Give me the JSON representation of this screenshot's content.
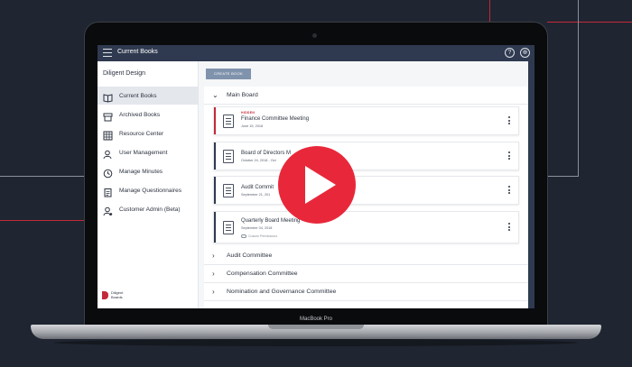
{
  "app": {
    "title": "Current Books",
    "org_name": "Diligent Design",
    "help_icon": "help-icon",
    "globe_icon": "globe-icon"
  },
  "sidebar": {
    "items": [
      {
        "label": "Current Books",
        "icon": "book-open-icon",
        "active": true
      },
      {
        "label": "Archived Books",
        "icon": "archive-icon",
        "active": false
      },
      {
        "label": "Resource Center",
        "icon": "grid-icon",
        "active": false
      },
      {
        "label": "User Management",
        "icon": "users-icon",
        "active": false
      },
      {
        "label": "Manage Minutes",
        "icon": "clock-icon",
        "active": false
      },
      {
        "label": "Manage Questionnaires",
        "icon": "clipboard-icon",
        "active": false
      },
      {
        "label": "Customer Admin (Beta)",
        "icon": "admin-icon",
        "active": false
      }
    ],
    "brand": {
      "line1": "Diligent",
      "line2": "Boards"
    }
  },
  "toolbar": {
    "create_label": "CREATE BOOK"
  },
  "sections": [
    {
      "label": "Main Board",
      "expanded": true
    },
    {
      "label": "Audit Committee",
      "expanded": false
    },
    {
      "label": "Compensation Committee",
      "expanded": false
    },
    {
      "label": "Nomination and Governance Committee",
      "expanded": false
    }
  ],
  "books": [
    {
      "tag": "HIDDEN",
      "title": "Finance Committee Meeting",
      "date": "June 15, 2018",
      "permissions": "",
      "stripe": "#c4293a"
    },
    {
      "tag": "",
      "title": "Board of Directors M",
      "date": "October 24, 2018 - Oct",
      "permissions": "",
      "stripe": "#2f3a50"
    },
    {
      "tag": "",
      "title": "Audit Commit",
      "date": "September 21, 201",
      "permissions": "",
      "stripe": "#2f3a50"
    },
    {
      "tag": "",
      "title": "Quarterly Board Meeting",
      "date": "September 04, 2018",
      "permissions": "Custom Permissions",
      "stripe": "#2f3a50"
    }
  ],
  "laptop": {
    "model": "MacBook Pro"
  },
  "colors": {
    "accent_red": "#e8283a",
    "nav_dark": "#2f3a50",
    "button": "#8093ad"
  }
}
